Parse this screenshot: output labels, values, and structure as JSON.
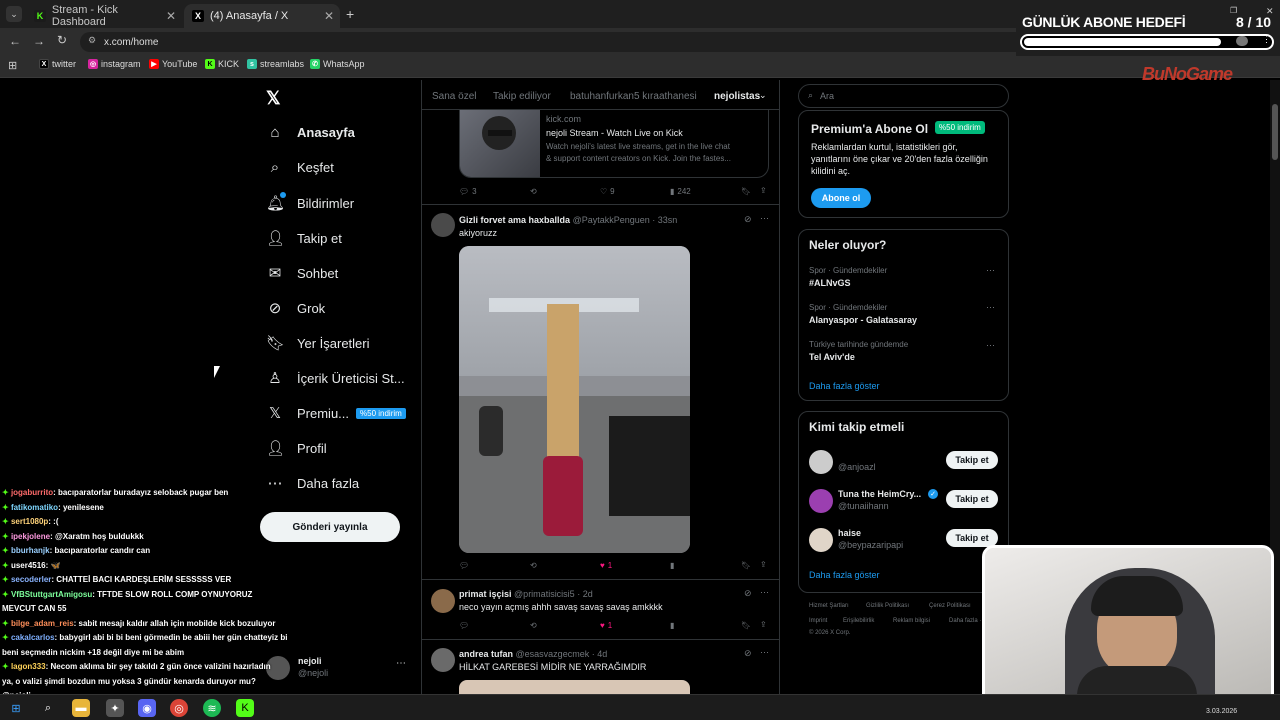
{
  "browser": {
    "tabs": [
      {
        "label": "Stream - Kick Dashboard",
        "favicon": "K"
      },
      {
        "label": "(4) Anasayfa / X",
        "favicon": "X"
      }
    ],
    "new_tab": "+",
    "url": "x.com/home",
    "bookmarks": [
      "twitter",
      "instagram",
      "YouTube",
      "KICK",
      "streamlabs",
      "WhatsApp"
    ]
  },
  "overlay": {
    "goal_title": "GÜNLÜK ABONE HEDEFİ",
    "goal_count": "8 / 10",
    "goal_progress": 0.8,
    "brand": "BuNoGame"
  },
  "nav": {
    "items": [
      {
        "label": "Anasayfa",
        "icon": "home-icon"
      },
      {
        "label": "Keşfet",
        "icon": "search-icon"
      },
      {
        "label": "Bildirimler",
        "icon": "bell-icon"
      },
      {
        "label": "Takip et",
        "icon": "follow-icon"
      },
      {
        "label": "Sohbet",
        "icon": "mail-icon"
      },
      {
        "label": "Grok",
        "icon": "grok-icon"
      },
      {
        "label": "Yer İşaretleri",
        "icon": "bookmark-icon"
      },
      {
        "label": "İçerik Üreticisi St...",
        "icon": "creator-icon"
      },
      {
        "label": "Premiu...",
        "icon": "x-icon"
      },
      {
        "label": "Profil",
        "icon": "profile-icon"
      },
      {
        "label": "Daha fazla",
        "icon": "more-icon"
      }
    ],
    "premium_badge": "%50 indirim",
    "post_button": "Gönderi yayınla",
    "account": {
      "name": "nejoli",
      "handle": "@nejoli"
    }
  },
  "feed": {
    "tabs": [
      "Sana özel",
      "Takip ediliyor",
      "batuhanfurkan5 kıraathanesi",
      "nejolistas"
    ],
    "link_card": {
      "domain": "kick.com",
      "title": "nejoli Stream - Watch Live on Kick",
      "desc1": "Watch nejoli's latest live streams, get in the live chat",
      "desc2": "& support content creators on Kick. Join the fastes..."
    },
    "post0_actions": {
      "replies": "3",
      "retweets": "",
      "likes": "9",
      "views": "242"
    },
    "posts": [
      {
        "name": "Gizli forvet ama haxballda",
        "handle": "@PaytakkPenguen · 33sn",
        "text": "akiyoruzz",
        "likes": "1"
      },
      {
        "name": "primat işçisi",
        "handle": "@primatisicisi5 · 2d",
        "text": "neco yayın açmış ahhh savaş savaş savaş amkkkk",
        "likes": "1"
      },
      {
        "name": "andrea tufan",
        "handle": "@esasvazgecmek · 4d",
        "text": "HİLKAT GAREBESİ MİDİR NE YARRAĞIMDIR"
      }
    ]
  },
  "right": {
    "search_placeholder": "Ara",
    "premium": {
      "title": "Premium'a Abone Ol",
      "badge": "%50 indirim",
      "line1": "Reklamlardan kurtul, istatistikleri gör,",
      "line2": "yanıtlarını öne çıkar ve 20'den fazla özelliğin",
      "line3": "kilidini aç.",
      "button": "Abone ol"
    },
    "trends_title": "Neler oluyor?",
    "trends": [
      {
        "context": "Spor · Gündemdekiler",
        "title": "#ALNvGS"
      },
      {
        "context": "Spor · Gündemdekiler",
        "title": "Alanyaspor - Galatasaray"
      },
      {
        "context": "Türkiye tarihinde gündemde",
        "title": "Tel Aviv'de"
      }
    ],
    "show_more": "Daha fazla göster",
    "who_title": "Kimi takip etmeli",
    "who": [
      {
        "name": "",
        "handle": "@anjoazl"
      },
      {
        "name": "Tuna the HeimCry...",
        "handle": "@tunaiihann"
      },
      {
        "name": "haise",
        "handle": "@beypazaripapi"
      }
    ],
    "follow_label": "Takip et",
    "footer": [
      "Hizmet Şartları",
      "Gizlilik Politikası",
      "Çerez Politikası",
      "Imprint",
      "Erişilebilirlik",
      "Reklam bilgisi",
      "Daha fazla ···",
      "© 2026 X Corp."
    ]
  },
  "chat": [
    {
      "user": "jogaburrito",
      "color": "#ff6b6b",
      "msg": ": bacıparatorlar buradayız seloback pugar ben"
    },
    {
      "user": "fatikomatiko",
      "color": "#7fd7ff",
      "msg": ": yenilesene"
    },
    {
      "user": "sert1080p",
      "color": "#ffd37a",
      "msg": ": :("
    },
    {
      "user": "ipekjolene",
      "color": "#ff9ae0",
      "msg": ": @Xaratm hoş buldukkk"
    },
    {
      "user": "bburhanjk",
      "color": "#9ad0ff",
      "msg": ": bacıparatorlar candır can"
    },
    {
      "user": "user4516",
      "color": "#ffffff",
      "msg": ": 🦋"
    },
    {
      "user": "secoderler",
      "color": "#8ab4ff",
      "msg": ": CHATTEİ BACI KARDEŞLERİM SESSSSS VER"
    },
    {
      "user": "VfBStuttgartAmigosu",
      "color": "#7dff9b",
      "msg": ": TFTDE SLOW ROLL COMP OYNUYORUZ"
    },
    {
      "user": "",
      "color": "#ffffff",
      "msg": "MEVCUT CAN 55"
    },
    {
      "user": "bilge_adam_reis",
      "color": "#ff8f5a",
      "msg": ": sabit mesajı kaldır allah için mobilde kick bozuluyor"
    },
    {
      "user": "cakalcarlos",
      "color": "#7fb0ff",
      "msg": ": babygirl abi bi bi beni görmedin be abiii her gün chatteyiz bi"
    },
    {
      "user": "",
      "color": "#ffffff",
      "msg": "beni seçmedin nickim +18 değil diye mi be abim"
    },
    {
      "user": "lagon333",
      "color": "#ffd35a",
      "msg": ": Necom aklıma bir şey takıldı 2 gün önce valizini hazırladın"
    },
    {
      "user": "",
      "color": "#ffffff",
      "msg": "ya, o valizi şimdi bozdun mu yoksa 3 gündür kenarda duruyor mu?"
    },
    {
      "user": "",
      "color": "#ffffff",
      "msg": "@nejoli"
    }
  ],
  "taskbar": {
    "date": "3.03.2026"
  }
}
